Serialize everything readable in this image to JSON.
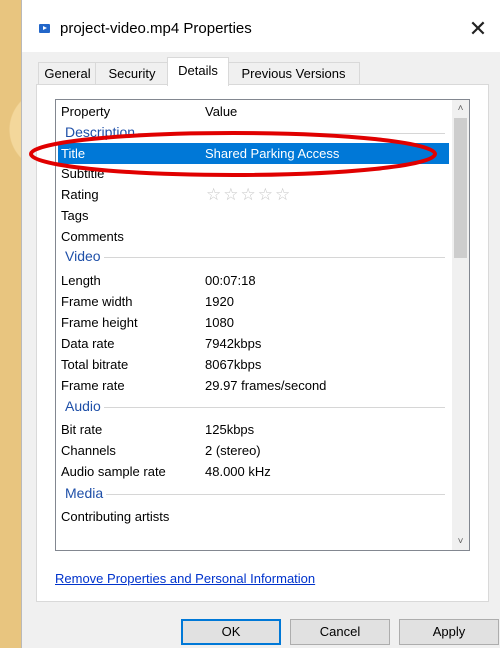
{
  "window": {
    "title": "project-video.mp4 Properties",
    "close_glyph": "✕"
  },
  "tabs": [
    {
      "label": "General",
      "active": false
    },
    {
      "label": "Security",
      "active": false
    },
    {
      "label": "Details",
      "active": true
    },
    {
      "label": "Previous Versions",
      "active": false
    }
  ],
  "list": {
    "header_property": "Property",
    "header_value": "Value",
    "sections": {
      "description": "Description",
      "video": "Video",
      "audio": "Audio",
      "media": "Media"
    },
    "rows": {
      "title": {
        "property": "Title",
        "value": "Shared Parking Access",
        "selected": true
      },
      "subtitle": {
        "property": "Subtitle",
        "value": ""
      },
      "rating": {
        "property": "Rating",
        "stars": "☆☆☆☆☆",
        "rating_value": 0,
        "rating_max": 5
      },
      "tags": {
        "property": "Tags",
        "value": ""
      },
      "comments": {
        "property": "Comments",
        "value": ""
      },
      "length": {
        "property": "Length",
        "value": "00:07:18"
      },
      "frame_width": {
        "property": "Frame width",
        "value": "1920"
      },
      "frame_height": {
        "property": "Frame height",
        "value": "1080"
      },
      "data_rate": {
        "property": "Data rate",
        "value": "7942kbps"
      },
      "total_bitrate": {
        "property": "Total bitrate",
        "value": "8067kbps"
      },
      "frame_rate": {
        "property": "Frame rate",
        "value": "29.97 frames/second"
      },
      "bit_rate": {
        "property": "Bit rate",
        "value": "125kbps"
      },
      "channels": {
        "property": "Channels",
        "value": "2 (stereo)"
      },
      "audio_sample_rate": {
        "property": "Audio sample rate",
        "value": "48.000 kHz"
      },
      "contributing_artists": {
        "property": "Contributing artists",
        "value": ""
      }
    },
    "scroll_up_glyph": "˄",
    "scroll_down_glyph": "˅"
  },
  "remove_link": "Remove Properties and Personal Information",
  "buttons": {
    "ok": "OK",
    "cancel": "Cancel",
    "apply": "Apply"
  },
  "colors": {
    "selection": "#0078d7",
    "section_text": "#1e4fa8",
    "annotation": "#e00000",
    "link": "#0033cc"
  }
}
